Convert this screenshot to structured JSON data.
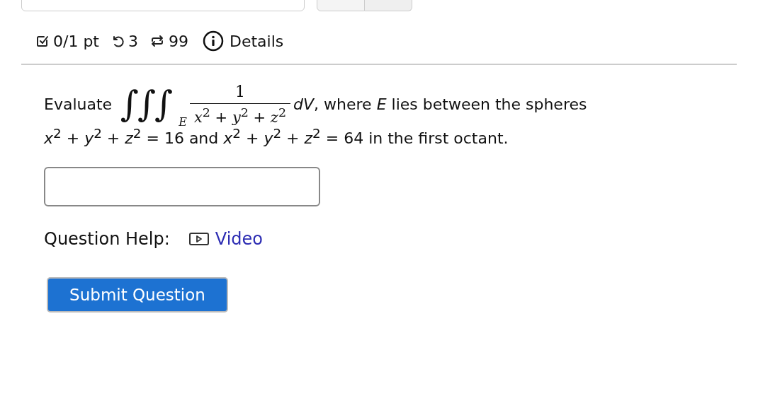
{
  "meta": [
    {
      "kind": "score",
      "text": "0/1 pt"
    },
    {
      "kind": "retries",
      "text": "3"
    },
    {
      "kind": "attempts",
      "text": "99"
    },
    {
      "kind": "details",
      "text": "Details"
    }
  ],
  "question": {
    "prefix": "Evaluate",
    "integral": "∫∫∫",
    "subscript": "E",
    "numerator": "1",
    "denominator": "*x*$^{2}$ + *y*$^{2}$ + *z*$^{2}$",
    "suffix": "*dV*, where *E* lies between the spheres",
    "line2": "*x*$^{2}$ + *y*$^{2}$ + *z*$^{2}$ = 16 and *x*$^{2}$ + *y*$^{2}$ + *z*$^{2}$ = 64 in the first octant."
  },
  "help": {
    "label": "Question Help:",
    "link": "Video"
  },
  "submit": "Submit Question"
}
